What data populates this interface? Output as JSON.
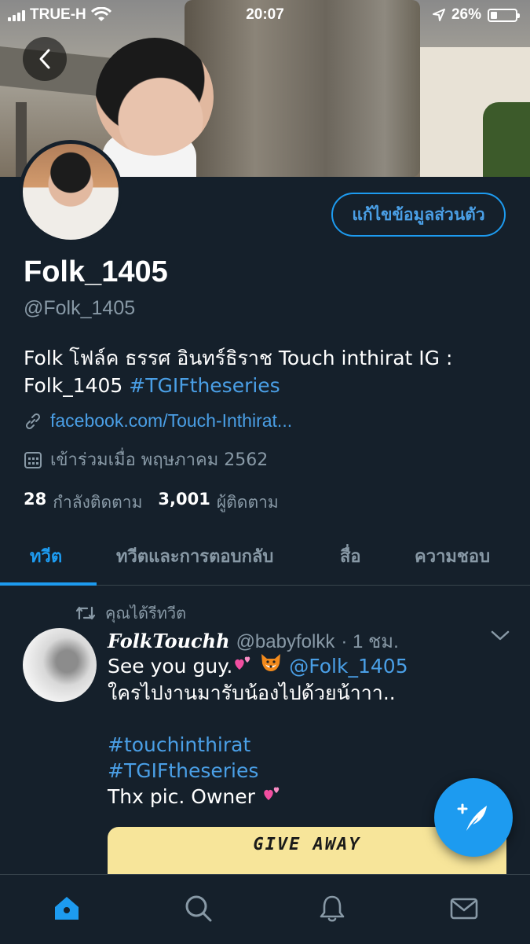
{
  "status_bar": {
    "carrier": "TRUE-H",
    "time": "20:07",
    "battery_text": "26%",
    "battery_level": 0.26
  },
  "profile": {
    "edit_button_label": "แก้ไขข้อมูลส่วนตัว",
    "display_name": "Folk_1405",
    "handle": "@Folk_1405",
    "bio_text": "Folk โฟล์ค ธรรศ อินทร์ธิราช Touch inthirat IG : Folk_1405",
    "bio_hashtag": "#TGIFtheseries",
    "link": "facebook.com/Touch-Inthirat...",
    "joined": "เข้าร่วมเมื่อ พฤษภาคม 2562",
    "following_count": "28",
    "following_label": "กำลังติดตาม",
    "followers_count": "3,001",
    "followers_label": "ผู้ติดตาม"
  },
  "tabs": [
    {
      "label": "ทวีต",
      "active": true
    },
    {
      "label": "ทวีตและการตอบกลับ",
      "active": false
    },
    {
      "label": "สื่อ",
      "active": false
    },
    {
      "label": "ความชอบ",
      "active": false
    }
  ],
  "tweet": {
    "retweet_label": "คุณได้รีทวีต",
    "author": "FolkTouchh",
    "handle": "@babyfolkk",
    "time": "· 1 ชม.",
    "line1_text": "See you guy.",
    "line1_mention": "@Folk_1405",
    "line2": "ใครไปงานมารับน้องไปด้วยน้าาา..",
    "hashtag1": "#touchinthirat",
    "hashtag2": "#TGIFtheseries",
    "line3": "Thx pic. Owner",
    "media_title": "GIVE AWAY"
  },
  "colors": {
    "background": "#15202b",
    "accent": "#1d9bf0",
    "secondary_text": "#8899a6",
    "divider": "#38444d"
  },
  "icons": {
    "back": "chevron-left-icon",
    "link": "link-icon",
    "calendar": "calendar-icon",
    "retweet": "retweet-icon",
    "more": "chevron-down-icon",
    "compose": "compose-feather-icon",
    "nav": [
      "home-icon",
      "search-icon",
      "bell-icon",
      "mail-icon"
    ]
  }
}
